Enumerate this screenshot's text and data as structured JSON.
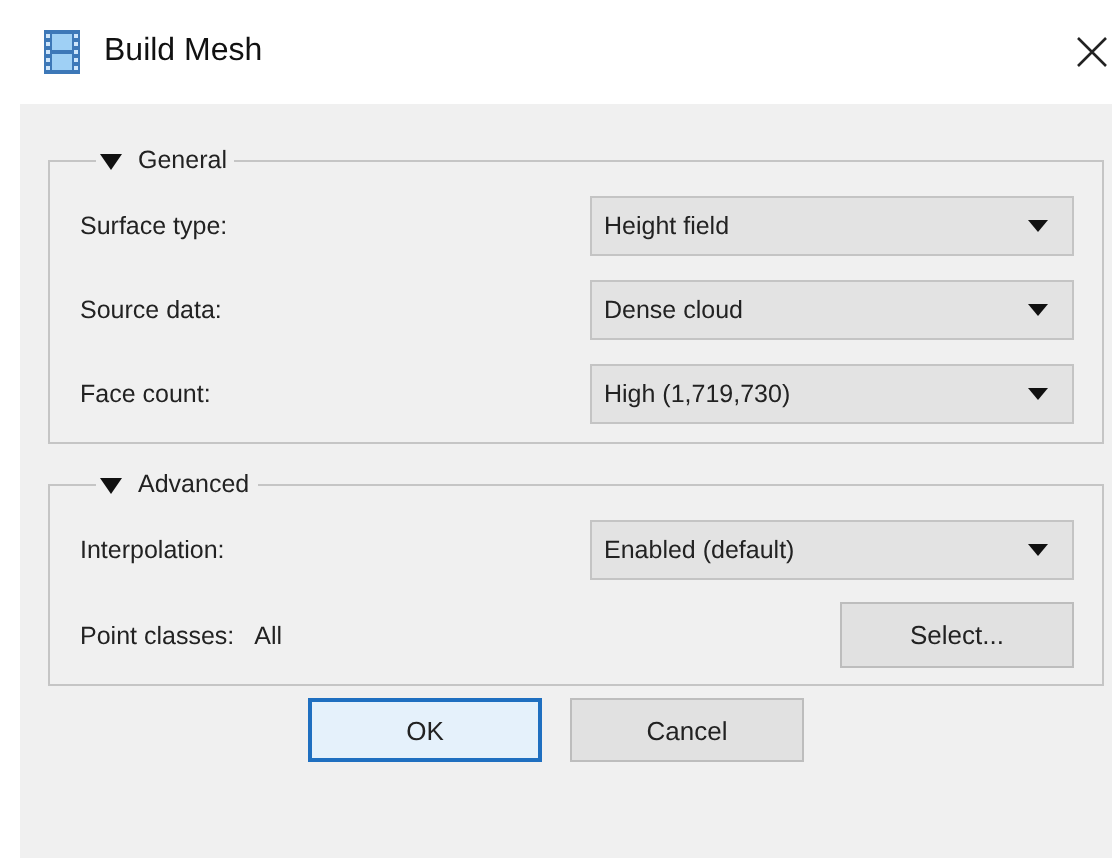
{
  "window": {
    "title": "Build Mesh"
  },
  "groups": [
    {
      "title": "General",
      "expanded": true,
      "rows": [
        {
          "kind": "dropdown",
          "label": "Surface type:",
          "value": "Height field"
        },
        {
          "kind": "dropdown",
          "label": "Source data:",
          "value": "Dense cloud"
        },
        {
          "kind": "dropdown",
          "label": "Face count:",
          "value": "High (1,719,730)"
        }
      ]
    },
    {
      "title": "Advanced",
      "expanded": true,
      "rows": [
        {
          "kind": "dropdown",
          "label": "Interpolation:",
          "value": "Enabled (default)"
        },
        {
          "kind": "picker",
          "label": "Point classes:",
          "value": "All",
          "button": "Select..."
        }
      ]
    }
  ],
  "buttons": [
    {
      "label": "OK",
      "default": true
    },
    {
      "label": "Cancel",
      "default": false
    }
  ]
}
